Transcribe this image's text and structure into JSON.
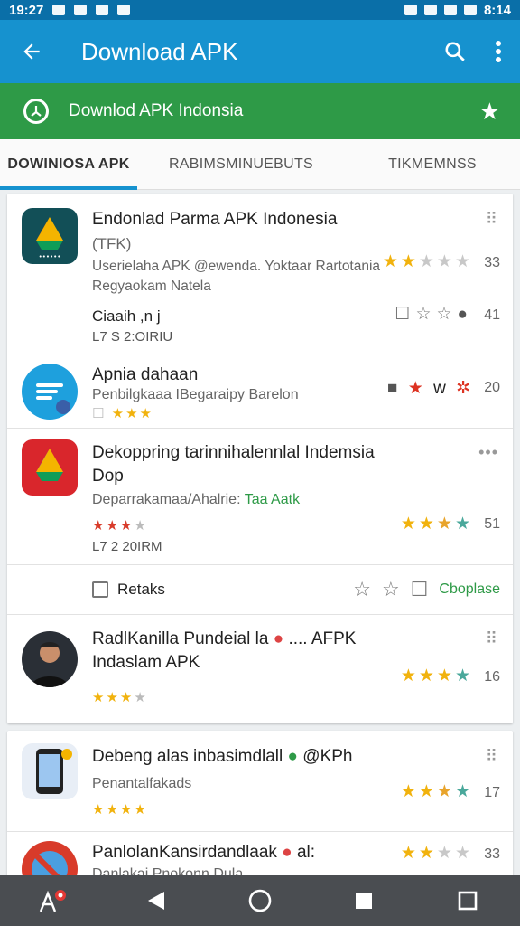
{
  "status": {
    "time_left": "19:27",
    "time_right": "8:14"
  },
  "appbar": {
    "title": "Download APK"
  },
  "banner": {
    "label": "Downlod APK Indonsia"
  },
  "tabs": [
    {
      "label": "DOWINIOSA APK",
      "active": true
    },
    {
      "label": "RABIMSMINUEBUTS",
      "active": false
    },
    {
      "label": "TIKMEMNSS",
      "active": false
    }
  ],
  "items": [
    {
      "title": "Endonlad Parma APK Indonesia",
      "subtitle": "(TFK)",
      "line1": "Userielaha APK @ewenda. Yoktaar Rartotania",
      "line2": "Regyaokam Natela",
      "line3": "Ciaaih ,n j",
      "line4": "L7 S 2:OIRIU",
      "count1": "33",
      "count2": "41"
    },
    {
      "title": "Apnia dahaan",
      "subtitle": "Penbilgkaaa IBegaraipy Barelon",
      "count": "20"
    },
    {
      "title": "Dekoppring tarinnihalennlal Indemsia",
      "title2": "Dop",
      "subtitle": "Deparrakamaa/Ahalrie:",
      "tag": "Taa Aatk",
      "meta": "L7 2 20IRM",
      "count": "51",
      "action_label": "Retaks",
      "action_right": "Cboplase"
    },
    {
      "title": "RadlKanilla Pundeial la",
      "title_tail": ".... AFPK",
      "title2": "Indaslam APK",
      "count": "16"
    },
    {
      "title": "Debeng alas inbasimdlall",
      "title_tail": "@KPh",
      "subtitle": "Penantalfakads",
      "count": "17"
    },
    {
      "title": "PanlolanKansirdandlaak",
      "title_tail": "al:",
      "subtitle": "Danlakai Pnokonn Dula",
      "count": "33"
    }
  ]
}
